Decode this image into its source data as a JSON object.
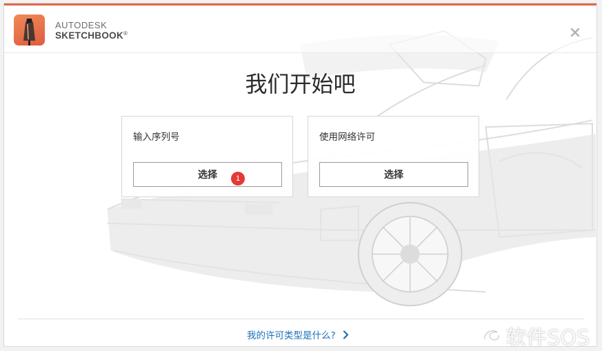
{
  "brand": {
    "line1": "AUTODESK",
    "line2": "SKETCHBOOK",
    "mark": "®"
  },
  "title": "我们开始吧",
  "cards": [
    {
      "label": "输入序列号",
      "button": "选择"
    },
    {
      "label": "使用网络许可",
      "button": "选择"
    }
  ],
  "annotation_marker": "1",
  "footer_link": "我的许可类型是什么?",
  "watermark": "软件SOS",
  "colors": {
    "accent": "#e0674a",
    "link": "#1b6fb8",
    "marker": "#e53935"
  },
  "icons": {
    "close": "close-icon",
    "chevron": "chevron-right-icon",
    "logo": "sketchbook-pencil-icon"
  }
}
